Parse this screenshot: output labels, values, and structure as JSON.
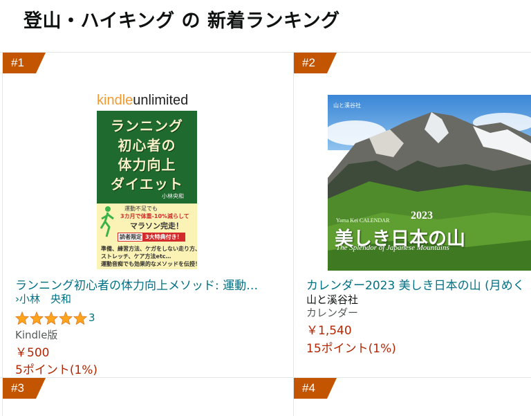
{
  "page": {
    "title": "登山・ハイキング の 新着ランキング"
  },
  "colors": {
    "badge": "#c45500",
    "link": "#007185",
    "price": "#b12704",
    "star": "#ffa41c"
  },
  "items": [
    {
      "rank": "#1",
      "title": "ランニング初心者の体力向上メソッド: 運動…",
      "author_chevron": "›",
      "author": "小林　央和",
      "rating": 5,
      "review_count": "3",
      "format": "Kindle版",
      "price": "￥500",
      "points": "5ポイント(1%)",
      "cover": {
        "ku_a": "kindle",
        "ku_b": "unlimited",
        "lines": [
          "ランニング",
          "初心者の",
          "体力向上",
          "ダイエット"
        ],
        "author": "小林央和",
        "promo1": "運動不足でも",
        "promo2": "3カ月で体重-10%減らして",
        "promo3": "マラソン完走！",
        "badge_a": "読者限定",
        "badge_b": "3大特典付き！",
        "bullets1": "準備、練習方法、ケガをしない走り方、",
        "bullets2": "ストレッチ、ケア方法etc…",
        "bullets3": "運動音痴でも効果的なメソッドを伝授！"
      }
    },
    {
      "rank": "#2",
      "title": "カレンダー2023 美しき日本の山 (月めく",
      "publisher": "山と溪谷社",
      "format": "カレンダー",
      "price": "￥1,540",
      "points": "15ポイント(1%)",
      "cover": {
        "brand": "山と溪谷社",
        "sub": "Yama Kei CALENDAR",
        "year": "2023",
        "title": "美しき日本の山",
        "eng": "The Splendor of Japanese Mountains"
      }
    },
    {
      "rank": "#3"
    },
    {
      "rank": "#4"
    }
  ]
}
